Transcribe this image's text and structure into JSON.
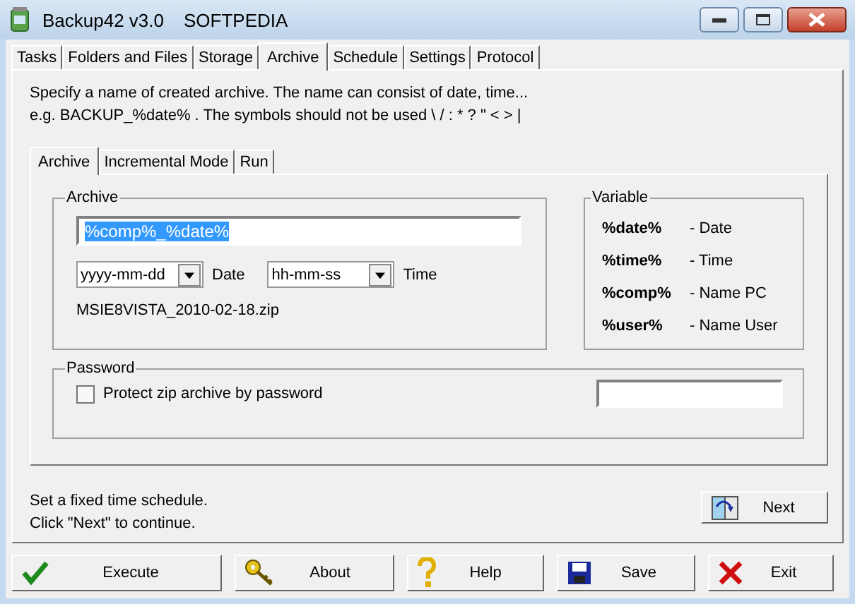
{
  "window": {
    "title": "Backup42 v3.0",
    "title_extra": "SOFTPEDIA"
  },
  "tabs": [
    {
      "label": "Tasks",
      "selected": false
    },
    {
      "label": "Folders and Files",
      "selected": false
    },
    {
      "label": "Storage",
      "selected": false
    },
    {
      "label": "Archive",
      "selected": true
    },
    {
      "label": "Schedule",
      "selected": false
    },
    {
      "label": "Settings",
      "selected": false
    },
    {
      "label": "Protocol",
      "selected": false
    }
  ],
  "description": [
    "Specify a name of created archive. The name can consist of date, time...",
    "e.g. BACKUP_%date% . The symbols should not be used \\ / : * ? \" < > |"
  ],
  "inner_tabs": [
    {
      "label": "Archive",
      "selected": true
    },
    {
      "label": "Incremental Mode",
      "selected": false
    },
    {
      "label": "Run",
      "selected": false
    }
  ],
  "archive": {
    "legend": "Archive",
    "name": {
      "value": "%comp%_%date%",
      "text_selected": true
    },
    "date_format": "yyyy-mm-dd",
    "date_label": "Date",
    "time_format": "hh-mm-ss",
    "time_label": "Time",
    "preview": "MSIE8VISTA_2010-02-18.zip"
  },
  "variable": {
    "legend": "Variable",
    "items": [
      {
        "code": "%date%",
        "meaning": "- Date"
      },
      {
        "code": "%time%",
        "meaning": "- Time"
      },
      {
        "code": "%comp%",
        "meaning": "- Name PC"
      },
      {
        "code": "%user%",
        "meaning": "- Name User"
      }
    ]
  },
  "password": {
    "legend": "Password",
    "checkbox": {
      "label": "Protect zip archive by password",
      "checked": false
    }
  },
  "hint": [
    "Set a fixed time schedule.",
    "Click \"Next\" to continue."
  ],
  "next_button": "Next",
  "buttons": [
    {
      "label": "Execute",
      "kind": "execute"
    },
    {
      "label": "About",
      "kind": "about"
    },
    {
      "label": "Help",
      "kind": "help"
    },
    {
      "label": "Save",
      "kind": "save"
    },
    {
      "label": "Exit",
      "kind": "exit"
    }
  ]
}
